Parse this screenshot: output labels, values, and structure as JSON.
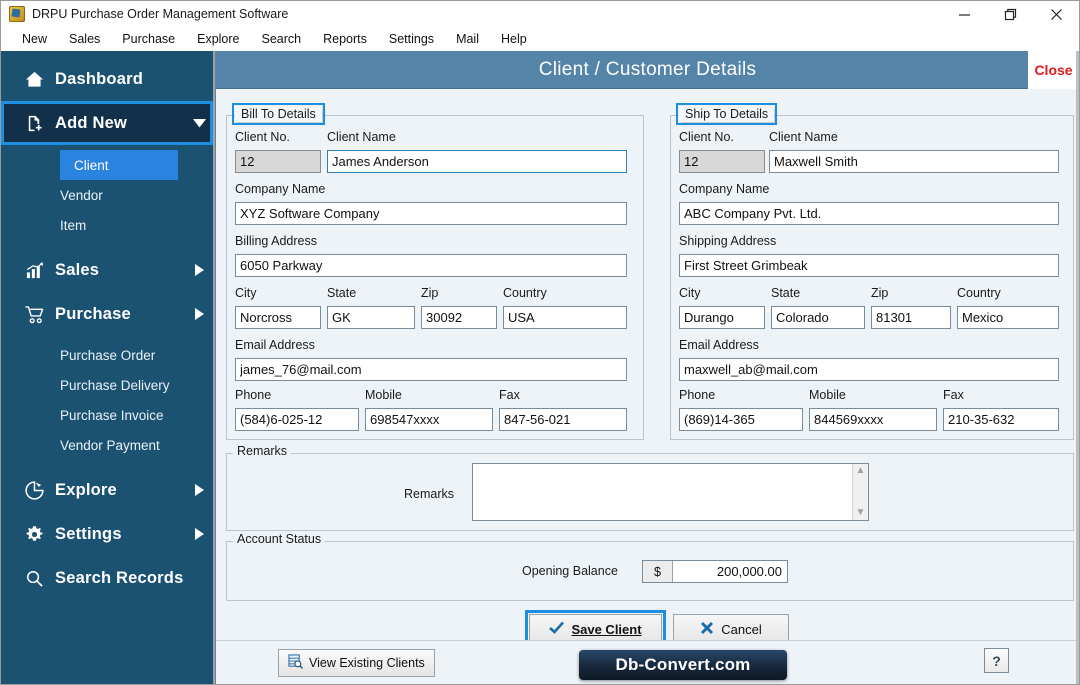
{
  "window": {
    "title": "DRPU Purchase Order Management Software",
    "app_icon": "app-logo-icon",
    "minimize": "minimize-icon",
    "maximize": "maximize-icon",
    "close": "close-icon"
  },
  "menubar": {
    "items": [
      {
        "label": "New"
      },
      {
        "label": "Sales"
      },
      {
        "label": "Purchase"
      },
      {
        "label": "Explore"
      },
      {
        "label": "Search"
      },
      {
        "label": "Reports"
      },
      {
        "label": "Settings"
      },
      {
        "label": "Mail"
      },
      {
        "label": "Help"
      }
    ]
  },
  "sidebar": {
    "items": [
      {
        "label": "Dashboard",
        "icon": "home-icon",
        "type": "top",
        "arrow": "none",
        "selected": false
      },
      {
        "label": "Add New",
        "icon": "document-add-icon",
        "type": "top",
        "arrow": "chevron-down-icon",
        "selected": true
      },
      {
        "label": "Client",
        "type": "sub",
        "active": true
      },
      {
        "label": "Vendor",
        "type": "sub",
        "active": false
      },
      {
        "label": "Item",
        "type": "sub",
        "active": false
      },
      {
        "label": "Sales",
        "icon": "bar-chart-icon",
        "type": "top",
        "arrow": "chevron-right-icon",
        "selected": false
      },
      {
        "label": "Purchase",
        "icon": "shopping-cart-icon",
        "type": "top",
        "arrow": "chevron-right-icon",
        "selected": false
      },
      {
        "label": "Purchase Order",
        "type": "sub",
        "active": false
      },
      {
        "label": "Purchase Delivery",
        "type": "sub",
        "active": false
      },
      {
        "label": "Purchase Invoice",
        "type": "sub",
        "active": false
      },
      {
        "label": "Vendor Payment",
        "type": "sub",
        "active": false
      },
      {
        "label": "Explore",
        "icon": "pie-chart-icon",
        "type": "top",
        "arrow": "chevron-right-icon",
        "selected": false
      },
      {
        "label": "Settings",
        "icon": "gear-icon",
        "type": "top",
        "arrow": "chevron-right-icon",
        "selected": false
      },
      {
        "label": "Search Records",
        "icon": "search-icon",
        "type": "top",
        "arrow": "none",
        "selected": false
      }
    ]
  },
  "panel": {
    "title": "Client / Customer Details",
    "close_label": "Close"
  },
  "bill_to": {
    "legend": "Bill To Details",
    "labels": {
      "client_no": "Client No.",
      "client_name": "Client Name",
      "company_name": "Company Name",
      "address": "Billing Address",
      "city": "City",
      "state": "State",
      "zip": "Zip",
      "country": "Country",
      "email": "Email Address",
      "phone": "Phone",
      "mobile": "Mobile",
      "fax": "Fax"
    },
    "values": {
      "client_no": "12",
      "client_name": "James Anderson",
      "company_name": "XYZ Software Company",
      "address": "6050 Parkway",
      "city": "Norcross",
      "state": "GK",
      "zip": "30092",
      "country": "USA",
      "email": "james_76@mail.com",
      "phone": "(584)6-025-12",
      "mobile": "698547xxxx",
      "fax": "847-56-021"
    }
  },
  "ship_to": {
    "legend": "Ship To Details",
    "labels": {
      "client_no": "Client No.",
      "client_name": "Client Name",
      "company_name": "Company Name",
      "address": "Shipping Address",
      "city": "City",
      "state": "State",
      "zip": "Zip",
      "country": "Country",
      "email": "Email Address",
      "phone": "Phone",
      "mobile": "Mobile",
      "fax": "Fax"
    },
    "values": {
      "client_no": "12",
      "client_name": "Maxwell Smith",
      "company_name": "ABC Company Pvt. Ltd.",
      "address": "First Street Grimbeak",
      "city": "Durango",
      "state": "Colorado",
      "zip": "81301",
      "country": "Mexico",
      "email": "maxwell_ab@mail.com",
      "phone": "(869)14-365",
      "mobile": "844569xxxx",
      "fax": "210-35-632"
    }
  },
  "copy_arrow": "arrow-right-icon",
  "remarks": {
    "legend": "Remarks",
    "label": "Remarks",
    "value": "",
    "placeholder": ""
  },
  "account_status": {
    "legend": "Account Status",
    "opening_balance_label": "Opening Balance",
    "currency_symbol": "$",
    "opening_balance_value": "200,000.00"
  },
  "actions": {
    "save_label": "Save Client",
    "save_icon": "check-icon",
    "cancel_label": "Cancel",
    "cancel_icon": "cross-icon"
  },
  "bottombar": {
    "view_existing_label": "View Existing Clients",
    "view_existing_icon": "table-search-icon",
    "brand": "Db-Convert.com",
    "help_icon": "question-mark-icon",
    "help_label": "?"
  },
  "colors": {
    "sidebar_bg": "#1b5272",
    "sidebar_selected_bg": "#123049",
    "accent_blue": "#1e8fe0",
    "sub_active_bg": "#2b83e0",
    "panel_header_bg": "#5484a8",
    "content_bg": "#eef3f8",
    "close_red": "#e01b1b"
  }
}
